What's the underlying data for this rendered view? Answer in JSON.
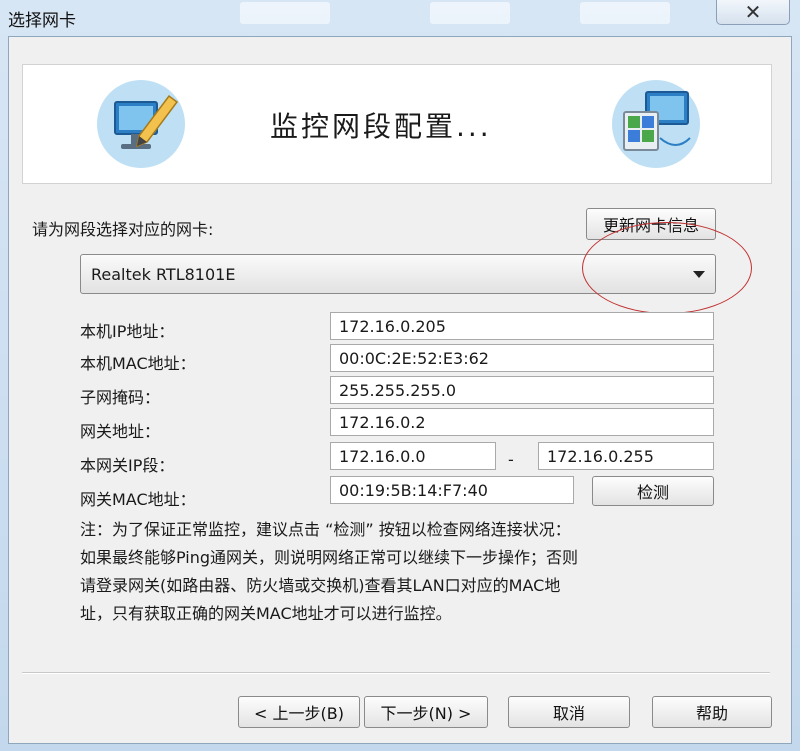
{
  "window": {
    "title": "选择网卡",
    "close_label": "✕"
  },
  "banner": {
    "title": "监控网段配置...",
    "left_icon": "monitor-pencil-icon",
    "right_icon": "network-computers-icon"
  },
  "adapter": {
    "prompt": "请为网段选择对应的网卡:",
    "refresh_button": "更新网卡信息",
    "selected": "Realtek RTL8101E"
  },
  "fields": {
    "ip_label": "本机IP地址：",
    "ip_value": "172.16.0.205",
    "mac_label": "本机MAC地址：",
    "mac_value": "00:0C:2E:52:E3:62",
    "mask_label": "子网掩码：",
    "mask_value": "255.255.255.0",
    "gateway_label": "网关地址：",
    "gateway_value": "172.16.0.2",
    "segment_label": "本网关IP段：",
    "segment_start": "172.16.0.0",
    "segment_dash": "-",
    "segment_end": "172.16.0.255",
    "gateway_mac_label": "网关MAC地址：",
    "gateway_mac_value": "00:19:5B:14:F7:40",
    "detect_button": "检测"
  },
  "note": {
    "line1": "注：为了保证正常监控，建议点击 “检测” 按钮以检查网络连接状况：",
    "line2": "如果最终能够Ping通网关，则说明网络正常可以继续下一步操作；否则",
    "line3": "请登录网关(如路由器、防火墙或交换机)查看其LAN口对应的MAC地",
    "line4": "址，只有获取正确的网关MAC地址才可以进行监控。"
  },
  "footer": {
    "back": "< 上一步(B)",
    "next": "下一步(N) >",
    "cancel": "取消",
    "help": "帮助"
  },
  "colors": {
    "annotation": "#c23030",
    "window_frame": "#c9dcef",
    "client": "#f0f0f0"
  }
}
